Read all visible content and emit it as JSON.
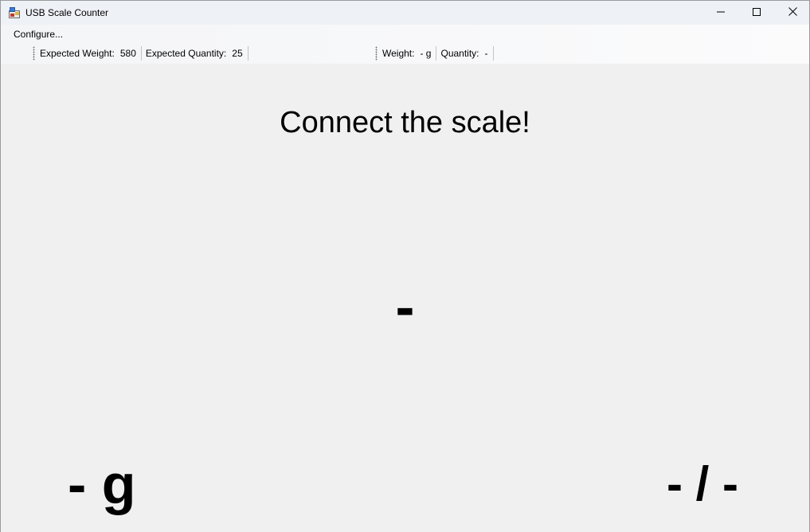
{
  "window": {
    "title": "USB Scale Counter",
    "icons": {
      "app": "scale-app-icon",
      "minimize": "minimize-icon",
      "maximize": "maximize-icon",
      "close": "close-icon"
    }
  },
  "menu": {
    "configure_label": "Configure..."
  },
  "toolbar_expected": {
    "weight_label": "Expected Weight:",
    "weight_value": "580",
    "quantity_label": "Expected Quantity:",
    "quantity_value": "25"
  },
  "toolbar_live": {
    "weight_label": "Weight:",
    "weight_value": "- g",
    "quantity_label": "Quantity:",
    "quantity_value": "-"
  },
  "main": {
    "status_message": "Connect the scale!",
    "center_value": "-",
    "weight_display": "- g",
    "quantity_display": "- / -"
  },
  "colors": {
    "background": "#f0f0f0",
    "titlebar": "#eef1f6",
    "text": "#000000"
  }
}
